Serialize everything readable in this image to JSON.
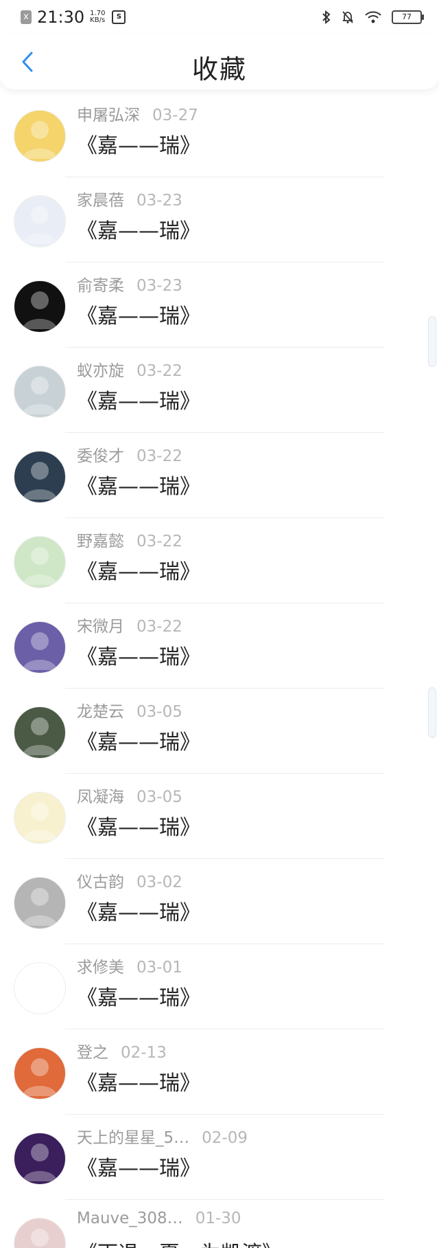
{
  "status_bar": {
    "notif_icon": "x",
    "time": "21:30",
    "speed_value": "1.70",
    "speed_unit": "KB/s",
    "app_icon": "S",
    "battery": "77"
  },
  "header": {
    "title": "收藏",
    "accent_color": "#2f8ef0"
  },
  "items": [
    {
      "name": "申屠弘深",
      "date": "03-27",
      "title": "《嘉——瑞》",
      "avatar_color": "#f4d46b"
    },
    {
      "name": "家晨蓓",
      "date": "03-23",
      "title": "《嘉——瑞》",
      "avatar_color": "#e9eef6"
    },
    {
      "name": "俞寄柔",
      "date": "03-23",
      "title": "《嘉——瑞》",
      "avatar_color": "#111111"
    },
    {
      "name": "蚁亦旋",
      "date": "03-22",
      "title": "《嘉——瑞》",
      "avatar_color": "#c8d2d6"
    },
    {
      "name": "委俊才",
      "date": "03-22",
      "title": "《嘉——瑞》",
      "avatar_color": "#2c3e50"
    },
    {
      "name": "野嘉懿",
      "date": "03-22",
      "title": "《嘉——瑞》",
      "avatar_color": "#cfe7c6"
    },
    {
      "name": "宋微月",
      "date": "03-22",
      "title": "《嘉——瑞》",
      "avatar_color": "#6b5fa8"
    },
    {
      "name": "龙楚云",
      "date": "03-05",
      "title": "《嘉——瑞》",
      "avatar_color": "#4b5a45"
    },
    {
      "name": "凤凝海",
      "date": "03-05",
      "title": "《嘉——瑞》",
      "avatar_color": "#f8f1d0"
    },
    {
      "name": "仪古韵",
      "date": "03-02",
      "title": "《嘉——瑞》",
      "avatar_color": "#b5b5b5"
    },
    {
      "name": "求修美",
      "date": "03-01",
      "title": "《嘉——瑞》",
      "avatar_color": "#ffffff"
    },
    {
      "name": "登之",
      "date": "02-13",
      "title": "《嘉——瑞》",
      "avatar_color": "#e06a3a"
    },
    {
      "name": "天上的星星_5…",
      "date": "02-09",
      "title": "《嘉——瑞》",
      "avatar_color": "#3b1e5c"
    },
    {
      "name": "Mauve_308…",
      "date": "01-30",
      "title": "《雨退一夏，为凯渡》",
      "avatar_color": "#e8cfcf"
    }
  ]
}
